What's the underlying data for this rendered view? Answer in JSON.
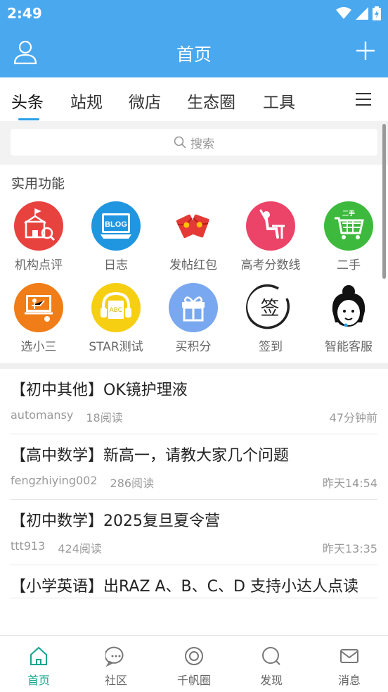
{
  "status": {
    "time": "2:49"
  },
  "header": {
    "title": "首页"
  },
  "tabs": [
    {
      "label": "头条",
      "active": true
    },
    {
      "label": "站规"
    },
    {
      "label": "微店"
    },
    {
      "label": "生态圈"
    },
    {
      "label": "工具"
    }
  ],
  "search": {
    "placeholder": "搜索"
  },
  "functions": {
    "heading": "实用功能",
    "items": [
      {
        "label": "机构点评",
        "icon": "school-icon",
        "color": "#e8423f"
      },
      {
        "label": "日志",
        "icon": "blog-icon",
        "color": "#2196e0",
        "badge": "BLOG"
      },
      {
        "label": "发帖红包",
        "icon": "red-envelope-icon",
        "color": "#e53935"
      },
      {
        "label": "高考分数线",
        "icon": "exam-icon",
        "color": "#ec4369"
      },
      {
        "label": "二手",
        "icon": "cart-icon",
        "color": "#3dba3d",
        "badge": "二手"
      },
      {
        "label": "选小三",
        "icon": "classroom-icon",
        "color": "#f07d17"
      },
      {
        "label": "STAR测试",
        "icon": "headphones-icon",
        "color": "#f6cf13",
        "badge": "ABC"
      },
      {
        "label": "买积分",
        "icon": "gift-icon",
        "color": "#7aa8f0"
      },
      {
        "label": "签到",
        "icon": "signin-icon",
        "color": "#333333",
        "badge": "签"
      },
      {
        "label": "智能客服",
        "icon": "customer-service-icon",
        "color": "#111111"
      }
    ]
  },
  "posts": [
    {
      "title": "【初中其他】OK镜护理液",
      "author": "automansy",
      "reads": "18阅读",
      "time": "47分钟前"
    },
    {
      "title": "【高中数学】新高一，请教大家几个问题",
      "author": "fengzhiying002",
      "reads": "286阅读",
      "time": "昨天14:54"
    },
    {
      "title": "【初中数学】2025复旦夏令营",
      "author": "ttt913",
      "reads": "424阅读",
      "time": "昨天13:35"
    },
    {
      "title": "【小学英语】出RAZ A、B、C、D 支持小达人点读",
      "author": "",
      "reads": "",
      "time": ""
    }
  ],
  "nav": [
    {
      "label": "首页",
      "active": true
    },
    {
      "label": "社区"
    },
    {
      "label": "千帆圈"
    },
    {
      "label": "发现"
    },
    {
      "label": "消息"
    }
  ],
  "colors": {
    "primary": "#4aa8ee",
    "accent": "#16a58e"
  }
}
